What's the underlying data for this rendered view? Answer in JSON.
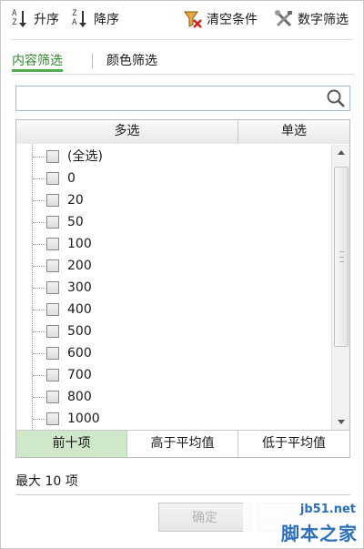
{
  "toolbar": {
    "sort_asc_label": "升序",
    "sort_desc_label": "降序",
    "clear_label": "清空条件",
    "number_filter_label": "数字筛选"
  },
  "tabs": [
    {
      "label": "内容筛选",
      "active": true
    },
    {
      "label": "颜色筛选",
      "active": false
    }
  ],
  "search": {
    "value": ""
  },
  "list_header": {
    "multi": "多选",
    "single": "单选"
  },
  "items": [
    "(全选)",
    "0",
    "20",
    "50",
    "100",
    "200",
    "300",
    "400",
    "500",
    "600",
    "700",
    "800",
    "1000"
  ],
  "filter_buttons": [
    {
      "label": "前十项",
      "active": true
    },
    {
      "label": "高于平均值",
      "active": false
    },
    {
      "label": "低于平均值",
      "active": false
    }
  ],
  "status": "最大 10 项",
  "buttons": {
    "ok": "确定"
  },
  "watermark": {
    "top": "jb51.net",
    "main": "脚本之家"
  },
  "colors": {
    "accent": "#4cae4c",
    "active_bg": "#cfe8c9",
    "watermark": "#2d6fbf"
  }
}
